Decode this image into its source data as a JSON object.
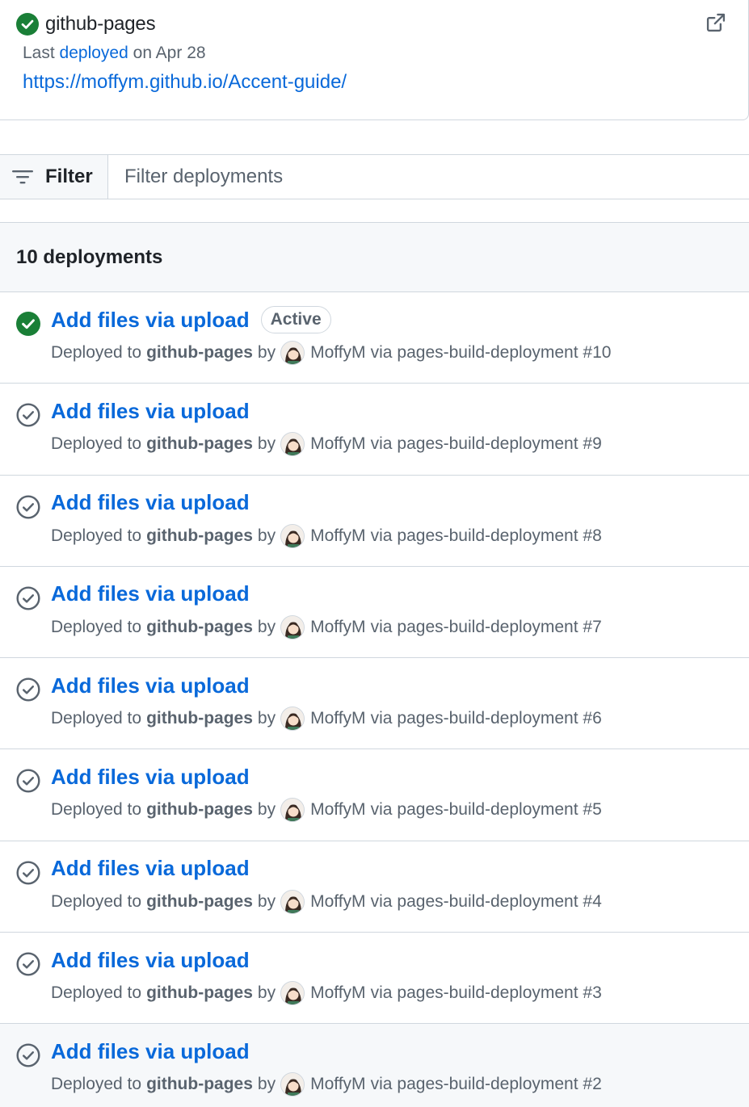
{
  "environment": {
    "name": "github-pages",
    "meta_prefix": "Last",
    "meta_link": "deployed",
    "meta_suffix": "on Apr 28",
    "url": "https://moffym.github.io/Accent-guide/",
    "status_icon": "check-circle-fill-icon",
    "external_icon": "link-external-icon"
  },
  "filter": {
    "button_label": "Filter",
    "placeholder": "Filter deployments"
  },
  "list": {
    "count_label": "10 deployments",
    "deployments": [
      {
        "commit": "Add files via upload",
        "badge": "Active",
        "prefix": "Deployed to",
        "env": "github-pages",
        "by": "by",
        "actor": "MoffyM",
        "via": "via",
        "workflow": "pages-build-deployment #10",
        "active": true
      },
      {
        "commit": "Add files via upload",
        "badge": "",
        "prefix": "Deployed to",
        "env": "github-pages",
        "by": "by",
        "actor": "MoffyM",
        "via": "via",
        "workflow": "pages-build-deployment #9",
        "active": false
      },
      {
        "commit": "Add files via upload",
        "badge": "",
        "prefix": "Deployed to",
        "env": "github-pages",
        "by": "by",
        "actor": "MoffyM",
        "via": "via",
        "workflow": "pages-build-deployment #8",
        "active": false
      },
      {
        "commit": "Add files via upload",
        "badge": "",
        "prefix": "Deployed to",
        "env": "github-pages",
        "by": "by",
        "actor": "MoffyM",
        "via": "via",
        "workflow": "pages-build-deployment #7",
        "active": false
      },
      {
        "commit": "Add files via upload",
        "badge": "",
        "prefix": "Deployed to",
        "env": "github-pages",
        "by": "by",
        "actor": "MoffyM",
        "via": "via",
        "workflow": "pages-build-deployment #6",
        "active": false
      },
      {
        "commit": "Add files via upload",
        "badge": "",
        "prefix": "Deployed to",
        "env": "github-pages",
        "by": "by",
        "actor": "MoffyM",
        "via": "via",
        "workflow": "pages-build-deployment #5",
        "active": false
      },
      {
        "commit": "Add files via upload",
        "badge": "",
        "prefix": "Deployed to",
        "env": "github-pages",
        "by": "by",
        "actor": "MoffyM",
        "via": "via",
        "workflow": "pages-build-deployment #4",
        "active": false
      },
      {
        "commit": "Add files via upload",
        "badge": "",
        "prefix": "Deployed to",
        "env": "github-pages",
        "by": "by",
        "actor": "MoffyM",
        "via": "via",
        "workflow": "pages-build-deployment #3",
        "active": false
      },
      {
        "commit": "Add files via upload",
        "badge": "",
        "prefix": "Deployed to",
        "env": "github-pages",
        "by": "by",
        "actor": "MoffyM",
        "via": "via",
        "workflow": "pages-build-deployment #2",
        "active": false
      }
    ]
  },
  "colors": {
    "success": "#1a7f37",
    "inactive_icon": "#59636e",
    "link": "#0969da"
  }
}
